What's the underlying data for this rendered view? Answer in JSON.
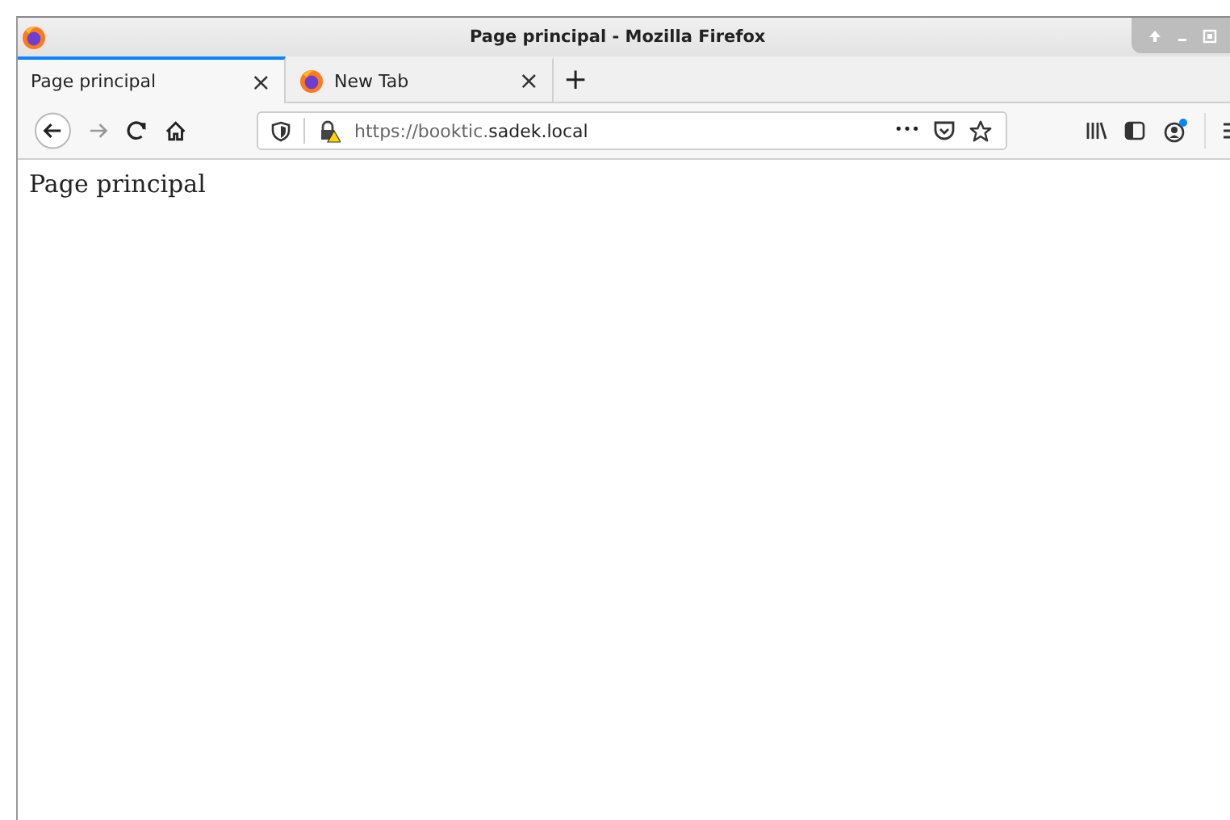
{
  "window": {
    "title": "Page principal - Mozilla Firefox"
  },
  "tabs": [
    {
      "label": "Page principal",
      "selected": true,
      "close": "×"
    },
    {
      "label": "New Tab",
      "selected": false,
      "close": "×"
    }
  ],
  "new_tab": "+",
  "address_bar": {
    "url_prefix": "https://booktic.",
    "url_domain": "sadek.local",
    "more": "•••"
  },
  "page": {
    "heading": "Page principal"
  },
  "account_notification": true
}
